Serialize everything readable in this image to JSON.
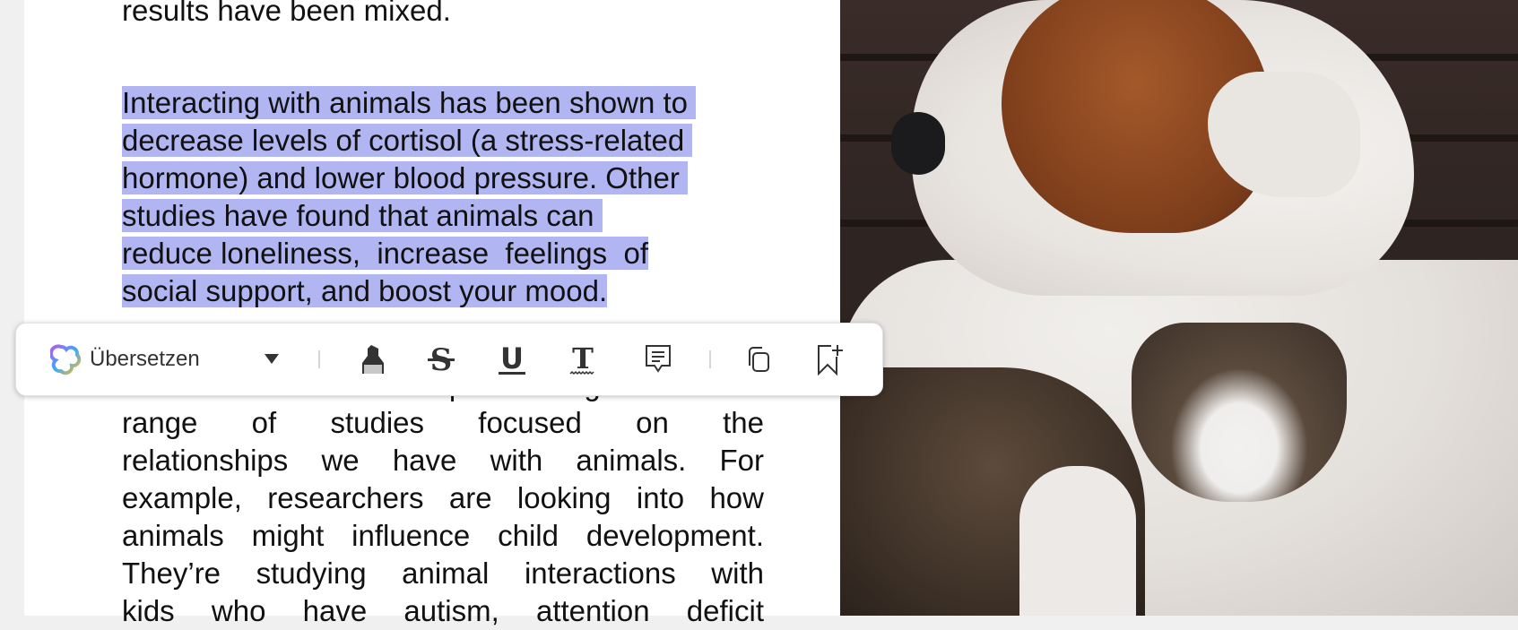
{
  "document": {
    "lines_top": [
      "results have been mixed."
    ],
    "selected_lines": [
      "Interacting with animals has been shown to ",
      "decrease levels of cortisol (a stress-related ",
      "hormone) and lower blood pressure. Other ",
      "studies have found that animals can ",
      "reduce loneliness,  increase  feelings  of",
      "social support, and boost your mood."
    ],
    "hidden_line": "The NIH/Mars Partnership is funding a",
    "lines_bottom": [
      "range  of  studies  focused  on  the",
      "relationships we have with animals. For",
      "example, researchers are looking into how",
      "animals might influence child development.",
      "They’re studying animal interactions with",
      "kids who have autism, attention deficit"
    ],
    "selection_color": "#b1b5f1"
  },
  "toolbar": {
    "translate_label": "Übersetzen",
    "tools": [
      "translate-logo",
      "dropdown-caret",
      "highlight",
      "strikethrough",
      "underline",
      "squiggly-underline",
      "comment",
      "copy",
      "add-bookmark"
    ]
  },
  "image": {
    "subject": "dog-and-cat-photo"
  }
}
